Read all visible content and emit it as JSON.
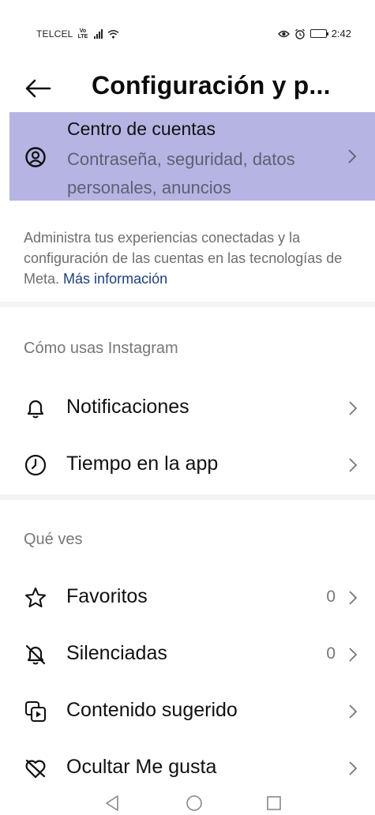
{
  "status_bar": {
    "carrier": "TELCEL",
    "volte_top": "Vo",
    "volte_bottom": "LTE",
    "time": "2:42"
  },
  "header": {
    "title": "Configuración y p...",
    "back_icon": "arrow-left-icon"
  },
  "accounts_center": {
    "title": "Centro de cuentas",
    "subtitle": "Contraseña, seguridad, datos personales, anuncios",
    "icon": "user-circle-icon",
    "highlight_color": "#b5b4e3"
  },
  "info": {
    "text": "Administra tus experiencias conectadas y la configuración de las cuentas en las tecnologías de Meta.",
    "link": "Más información",
    "link_color": "#1e3f7a"
  },
  "sections": [
    {
      "title": "Cómo usas Instagram",
      "items": [
        {
          "label": "Notificaciones",
          "icon": "bell-icon",
          "count": ""
        },
        {
          "label": "Tiempo en la app",
          "icon": "clock-icon",
          "count": ""
        }
      ]
    },
    {
      "title": "Qué ves",
      "items": [
        {
          "label": "Favoritos",
          "icon": "star-icon",
          "count": "0"
        },
        {
          "label": "Silenciadas",
          "icon": "bell-off-icon",
          "count": "0"
        },
        {
          "label": "Contenido sugerido",
          "icon": "media-play-icon",
          "count": ""
        },
        {
          "label": "Ocultar Me gusta",
          "icon": "heart-off-icon",
          "count": ""
        }
      ]
    }
  ],
  "nav_bar": {
    "back": "nav-back-icon",
    "home": "nav-home-icon",
    "recents": "nav-recents-icon"
  }
}
